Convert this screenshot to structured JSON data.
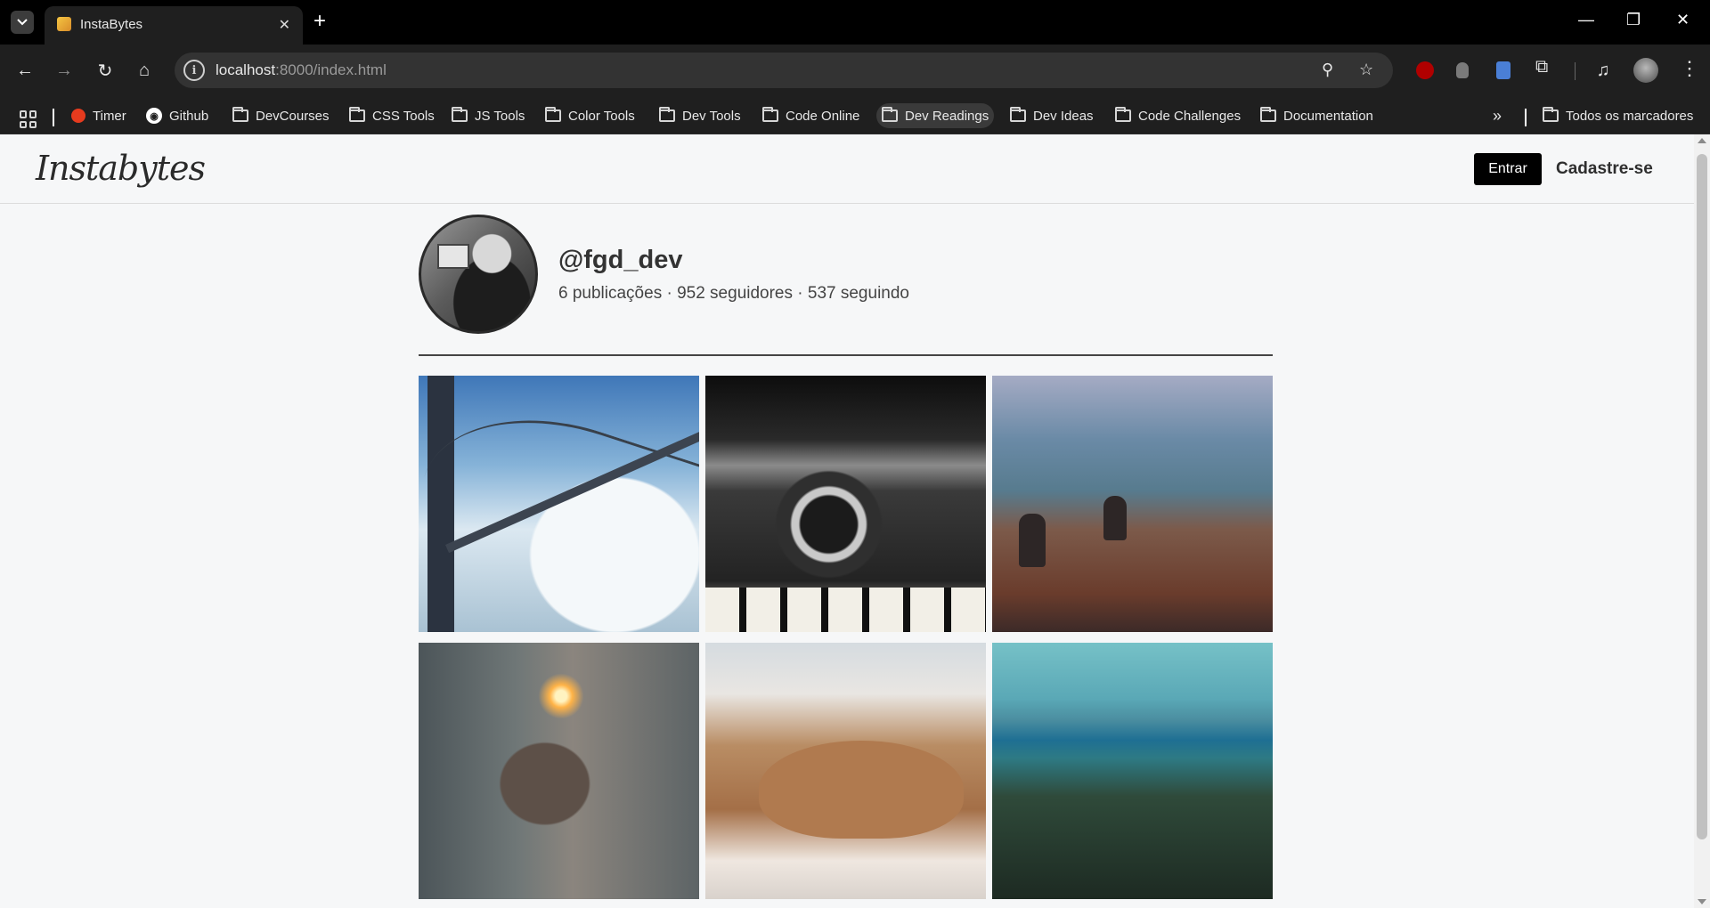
{
  "browser": {
    "tab_title": "InstaBytes",
    "url_host": "localhost",
    "url_rest": ":8000/index.html",
    "bookmarks": [
      {
        "label": "Timer",
        "icon": "tomato-icon"
      },
      {
        "label": "Github",
        "icon": "github-icon"
      },
      {
        "label": "DevCourses",
        "icon": "folder-icon"
      },
      {
        "label": "CSS Tools",
        "icon": "folder-icon"
      },
      {
        "label": "JS Tools",
        "icon": "folder-icon"
      },
      {
        "label": "Color Tools",
        "icon": "folder-icon"
      },
      {
        "label": "Dev Tools",
        "icon": "folder-icon"
      },
      {
        "label": "Code Online",
        "icon": "folder-icon"
      },
      {
        "label": "Dev Readings",
        "icon": "folder-icon"
      },
      {
        "label": "Dev Ideas",
        "icon": "folder-icon"
      },
      {
        "label": "Code Challenges",
        "icon": "folder-icon"
      },
      {
        "label": "Documentation",
        "icon": "folder-icon"
      }
    ],
    "all_bookmarks": "Todos os marcadores"
  },
  "site": {
    "logo": "Instabytes",
    "login_label": "Entrar",
    "signup_label": "Cadastre-se"
  },
  "profile": {
    "username": "@fgd_dev",
    "stats": "6 publicações · 952 seguidores · 537 seguindo"
  },
  "posts": [
    {
      "subject": "bridge-in-fog"
    },
    {
      "subject": "vintage-camera"
    },
    {
      "subject": "people-in-field"
    },
    {
      "subject": "sparkler-in-hands"
    },
    {
      "subject": "walrus-on-ice"
    },
    {
      "subject": "forest-and-lake"
    }
  ]
}
